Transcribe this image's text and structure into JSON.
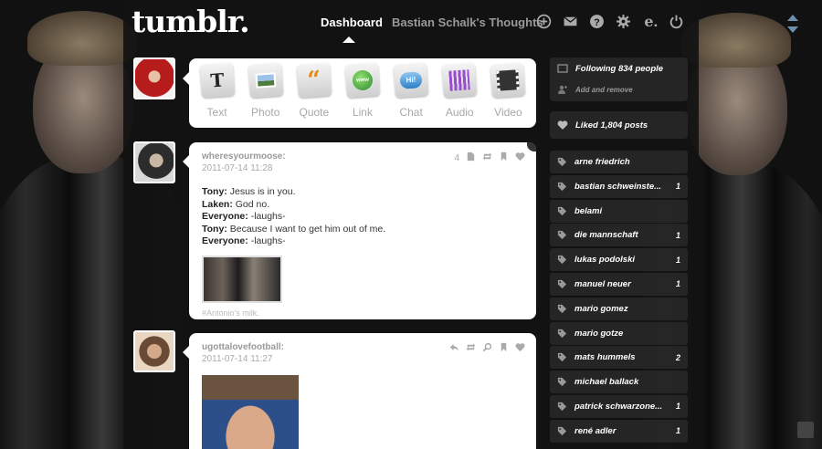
{
  "header": {
    "logo": "tumblr.",
    "nav_dashboard": "Dashboard",
    "nav_blog": "Bastian Schalk's Thoughts",
    "icons": [
      "new-post-icon",
      "mail-icon",
      "help-icon",
      "settings-icon",
      "edit-icon",
      "power-icon"
    ]
  },
  "post_types": [
    {
      "label": "Text",
      "icon": "text-icon"
    },
    {
      "label": "Photo",
      "icon": "photo-icon"
    },
    {
      "label": "Quote",
      "icon": "quote-icon"
    },
    {
      "label": "Link",
      "icon": "link-icon",
      "glyph": "www"
    },
    {
      "label": "Chat",
      "icon": "chat-icon",
      "glyph": "Hi!"
    },
    {
      "label": "Audio",
      "icon": "audio-icon"
    },
    {
      "label": "Video",
      "icon": "video-icon"
    }
  ],
  "posts": [
    {
      "author": "wheresyourmoose:",
      "date": "2011-07-14 11:28",
      "note_count": "4",
      "lines": [
        {
          "speaker": "Tony:",
          "text": " Jesus is in you."
        },
        {
          "speaker": "Laken:",
          "text": " God no."
        },
        {
          "speaker": "Everyone:",
          "text": " -laughs-"
        },
        {
          "speaker": "Tony:",
          "text": " Because I want to get him out of me."
        },
        {
          "speaker": "Everyone:",
          "text": " -laughs-"
        }
      ],
      "tag": "#Antonio's milk."
    },
    {
      "author": "ugottalovefootball:",
      "date": "2011-07-14 11:27"
    }
  ],
  "sidebar": {
    "following": "Following 834 people",
    "add_remove": "Add and remove",
    "liked": "Liked 1,804 posts",
    "tags": [
      {
        "name": "arne friedrich",
        "count": ""
      },
      {
        "name": "bastian schweinste...",
        "count": "1"
      },
      {
        "name": "belami",
        "count": ""
      },
      {
        "name": "die mannschaft",
        "count": "1"
      },
      {
        "name": "lukas podolski",
        "count": "1"
      },
      {
        "name": "manuel neuer",
        "count": "1"
      },
      {
        "name": "mario gomez",
        "count": ""
      },
      {
        "name": "mario gotze",
        "count": ""
      },
      {
        "name": "mats hummels",
        "count": "2"
      },
      {
        "name": "michael ballack",
        "count": ""
      },
      {
        "name": "patrick schwarzone...",
        "count": "1"
      },
      {
        "name": "rené adler",
        "count": "1"
      }
    ]
  },
  "colors": {
    "background": "#111111",
    "post_bg": "#ffffff",
    "sidebar_bg": "#282828",
    "accent_quote": "#e58a1a"
  }
}
